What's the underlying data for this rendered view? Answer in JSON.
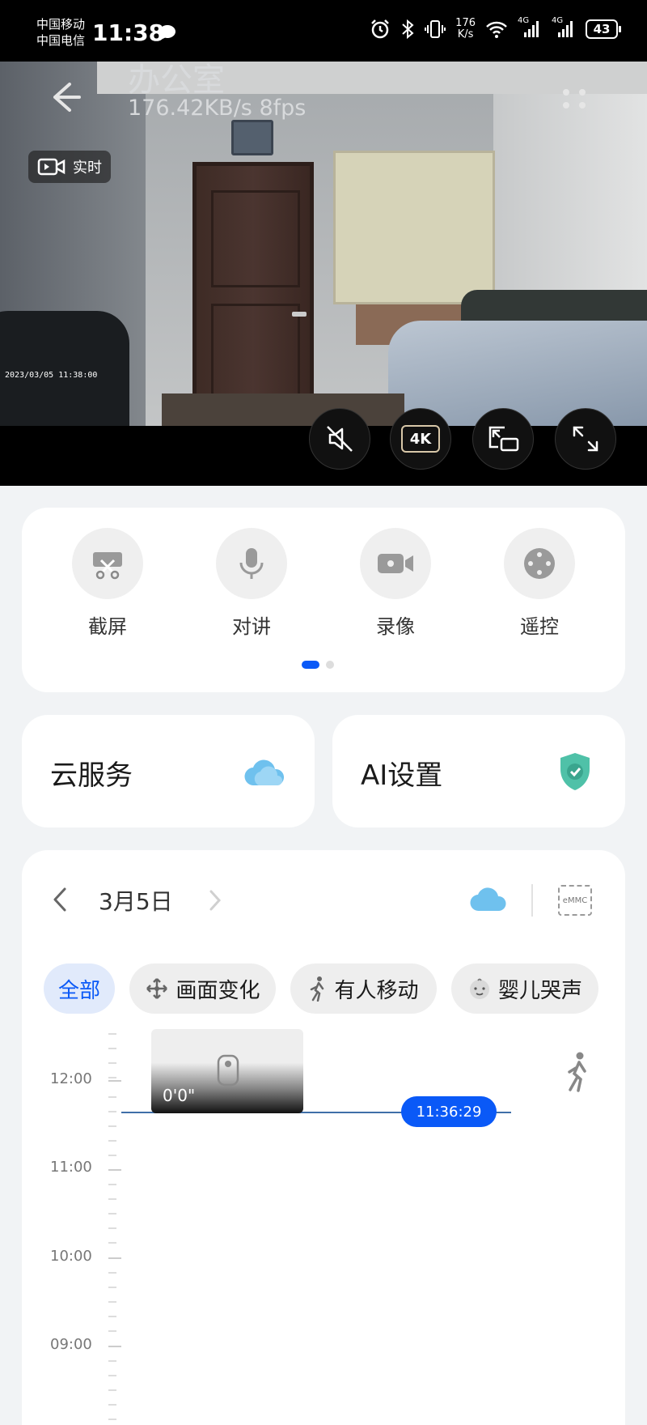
{
  "status_bar": {
    "carrier_1": "中国移动",
    "carrier_2": "中国电信",
    "time": "11:38",
    "net_speed_value": "176",
    "net_speed_unit": "K/s",
    "signal_1_label": "4G",
    "signal_2_label": "4G",
    "battery": "43"
  },
  "video": {
    "title": "办公室",
    "stream_info": "176.42KB/s   8fps",
    "live_label": "实时",
    "timestamp": "2023/03/05  11:38:00",
    "quality_label": "4K"
  },
  "quick_actions": [
    {
      "label": "截屏",
      "icon": "scissors-icon"
    },
    {
      "label": "对讲",
      "icon": "microphone-icon"
    },
    {
      "label": "录像",
      "icon": "video-camera-icon"
    },
    {
      "label": "遥控",
      "icon": "remote-control-icon"
    }
  ],
  "quick_actions_page": {
    "current": 1,
    "total": 2
  },
  "services": {
    "cloud_label": "云服务",
    "ai_label": "AI设置"
  },
  "timeline": {
    "date": "3月5日",
    "storage_label": "eMMC",
    "filters": [
      {
        "label": "全部",
        "active": true
      },
      {
        "label": "画面变化",
        "active": false
      },
      {
        "label": "有人移动",
        "active": false
      },
      {
        "label": "婴儿哭声",
        "active": false
      }
    ],
    "hours": [
      "12:00",
      "11:00",
      "10:00",
      "09:00"
    ],
    "clip_duration": "0'0\"",
    "current_time": "11:36:29"
  },
  "colors": {
    "accent": "#0a59f7",
    "page_bg": "#f1f3f5",
    "card_bg": "#ffffff",
    "cloud_blue": "#6fc1ee",
    "shield_teal": "#4fc1a8"
  }
}
